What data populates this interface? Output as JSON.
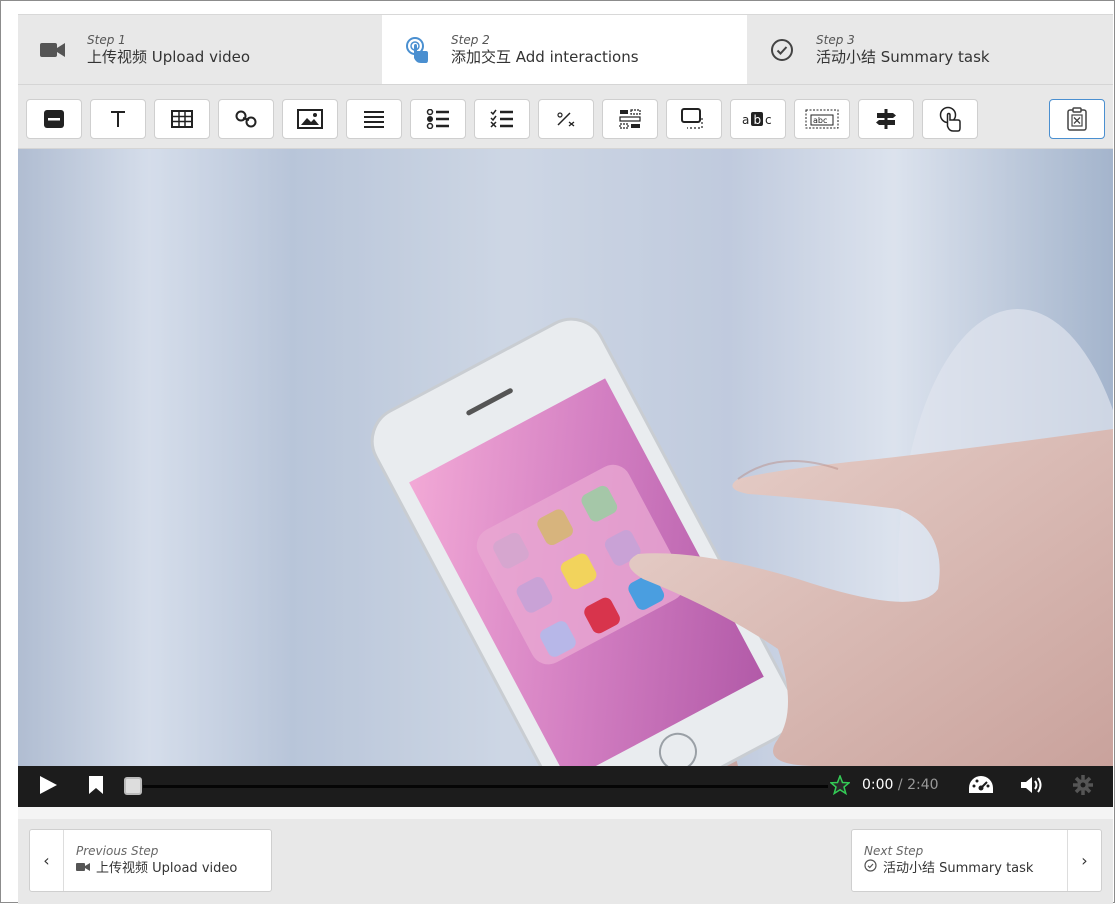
{
  "steps": [
    {
      "num": "Step 1",
      "label": "上传视频 Upload video",
      "icon": "video-camera-icon",
      "active": false
    },
    {
      "num": "Step 2",
      "label": "添加交互 Add interactions",
      "icon": "pointer-touch-icon",
      "active": true
    },
    {
      "num": "Step 3",
      "label": "活动小结 Summary task",
      "icon": "check-circle-icon",
      "active": false
    }
  ],
  "toolbar": {
    "items": [
      "label-icon",
      "text-icon",
      "table-icon",
      "link-icon",
      "image-icon",
      "statements-icon",
      "single-choice-icon",
      "multiple-choice-icon",
      "fill-blanks-icon",
      "drag-drop-icon",
      "drag-text-icon",
      "mark-words-icon",
      "free-text-icon",
      "crossroads-icon",
      "navigation-hotspot-icon"
    ],
    "special": "submit-screen-icon"
  },
  "player": {
    "current_time": "0:00",
    "total_time": "/ 2:40",
    "progress": 0
  },
  "footer": {
    "prev": {
      "caption": "Previous Step",
      "label": "上传视频 Upload video",
      "arrow": "‹"
    },
    "next": {
      "caption": "Next Step",
      "label": "活动小结 Summary task",
      "arrow": "›"
    }
  },
  "colors": {
    "accent": "#4a8fd0",
    "panel": "#e8e8e8",
    "controls": "#1c1c1c"
  }
}
